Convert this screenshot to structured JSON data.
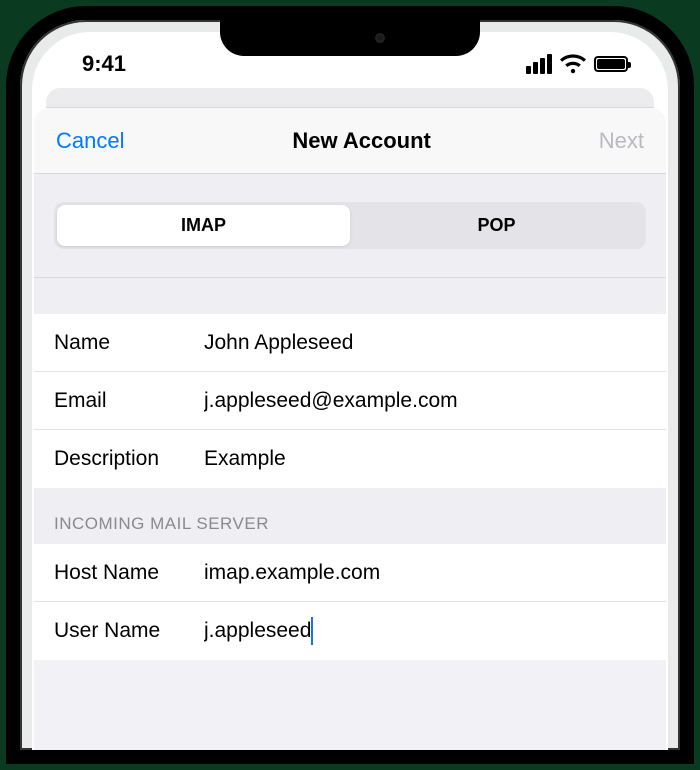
{
  "status": {
    "time": "9:41"
  },
  "nav": {
    "cancel": "Cancel",
    "title": "New Account",
    "next": "Next"
  },
  "segmented": {
    "imap": "IMAP",
    "pop": "POP",
    "selected": "IMAP"
  },
  "account": {
    "name_label": "Name",
    "name_value": "John Appleseed",
    "email_label": "Email",
    "email_value": "j.appleseed@example.com",
    "desc_label": "Description",
    "desc_value": "Example"
  },
  "incoming": {
    "header": "INCOMING MAIL SERVER",
    "host_label": "Host Name",
    "host_value": "imap.example.com",
    "user_label": "User Name",
    "user_value": "j.appleseed"
  }
}
